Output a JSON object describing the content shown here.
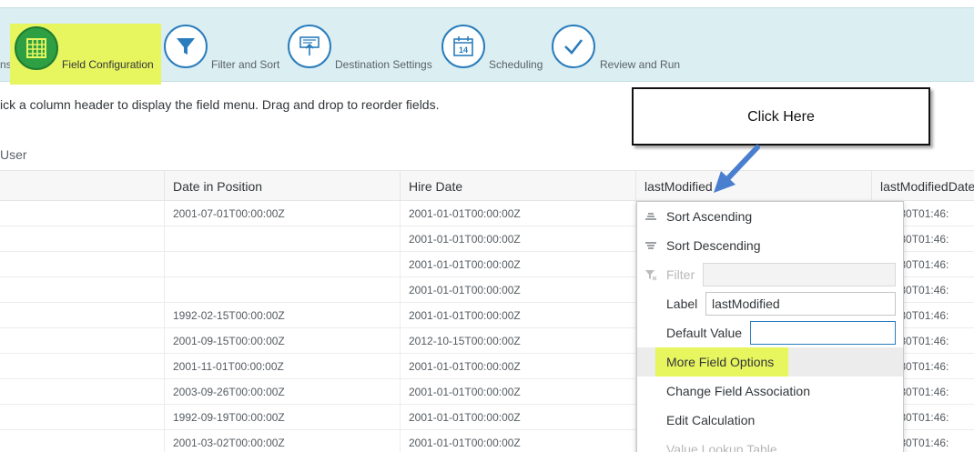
{
  "wizard": {
    "cut_step_label": "ns",
    "steps": [
      {
        "label": "Field Configuration",
        "icon": "table-grid-icon",
        "active": true
      },
      {
        "label": "Filter and Sort",
        "icon": "filter-icon"
      },
      {
        "label": "Destination Settings",
        "icon": "export-icon"
      },
      {
        "label": "Scheduling",
        "icon": "calendar-icon"
      },
      {
        "label": "Review and Run",
        "icon": "checkmark-icon"
      }
    ],
    "calendar_day": "14",
    "accent_color": "#2a7dbd",
    "active_color": "#2ea043",
    "highlight_color": "#e7f55f"
  },
  "instruction": "ick a column header to display the field menu. Drag and drop to reorder fields.",
  "section_title": "User",
  "table": {
    "headers": [
      "",
      "Date in Position",
      "Hire Date",
      "lastModified",
      "lastModifiedDate"
    ],
    "rows": [
      [
        "",
        "2001-07-01T00:00:00Z",
        "2001-01-01T00:00:00Z",
        "",
        "-07-30T01:46:"
      ],
      [
        "",
        "",
        "2001-01-01T00:00:00Z",
        "",
        "-07-30T01:46:"
      ],
      [
        "",
        "",
        "2001-01-01T00:00:00Z",
        "",
        "-07-30T01:46:"
      ],
      [
        "",
        "",
        "2001-01-01T00:00:00Z",
        "",
        "-07-30T01:46:"
      ],
      [
        "",
        "1992-02-15T00:00:00Z",
        "2001-01-01T00:00:00Z",
        "",
        "-07-30T01:46:"
      ],
      [
        "",
        "2001-09-15T00:00:00Z",
        "2012-10-15T00:00:00Z",
        "",
        "-07-30T01:46:"
      ],
      [
        "",
        "2001-11-01T00:00:00Z",
        "2001-01-01T00:00:00Z",
        "",
        "-07-30T01:46:"
      ],
      [
        "",
        "2003-09-26T00:00:00Z",
        "2001-01-01T00:00:00Z",
        "",
        "-07-30T01:46:"
      ],
      [
        "",
        "1992-09-19T00:00:00Z",
        "2001-01-01T00:00:00Z",
        "",
        "-07-30T01:46:"
      ],
      [
        "",
        "2001-03-02T00:00:00Z",
        "2001-01-01T00:00:00Z",
        "",
        "-07-30T01:46:"
      ]
    ]
  },
  "field_menu": {
    "sort_ascending": "Sort Ascending",
    "sort_descending": "Sort Descending",
    "filter_label": "Filter",
    "filter_value": "",
    "label_label": "Label",
    "label_value": "lastModified",
    "default_value_label": "Default Value",
    "default_value_value": "",
    "more_field_options": "More Field Options",
    "change_field_association": "Change Field Association",
    "edit_calculation": "Edit Calculation",
    "value_lookup_table": "Value Lookup Table"
  },
  "callout": {
    "text": "Click Here",
    "arrow_color": "#4a7fd0"
  }
}
